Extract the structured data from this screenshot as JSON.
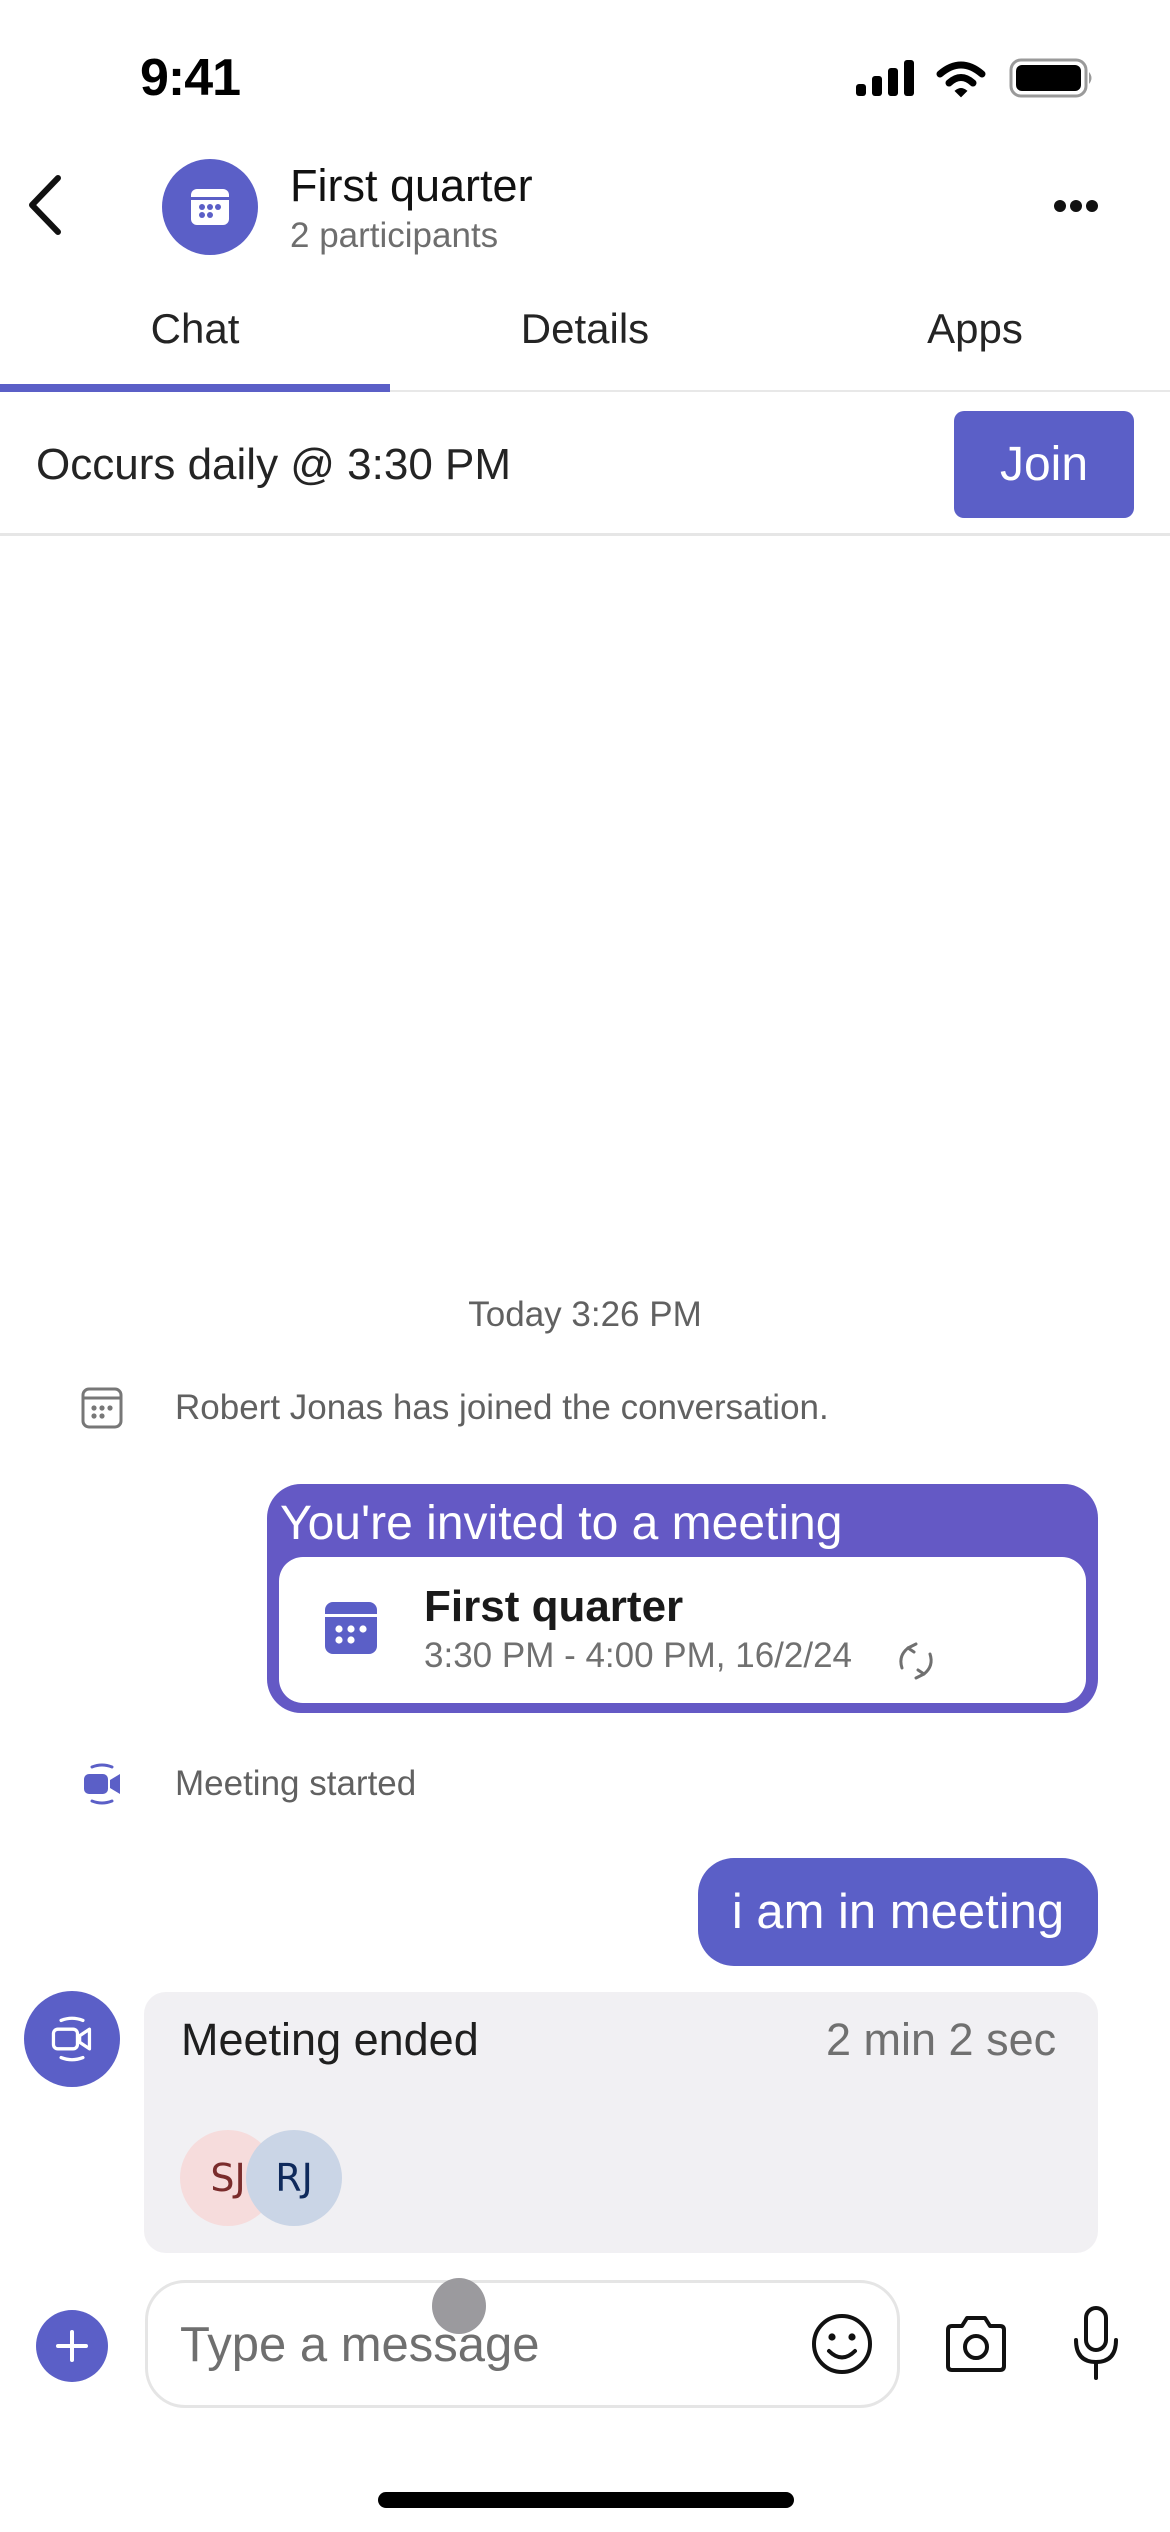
{
  "status_bar": {
    "time": "9:41",
    "icons": [
      "cellular-signal-icon",
      "wifi-icon",
      "battery-icon"
    ]
  },
  "header": {
    "back_icon": "chevron-left-icon",
    "avatar_icon": "calendar-icon",
    "title": "First quarter",
    "subtitle": "2 participants",
    "more_icon": "more-horizontal-icon"
  },
  "tabs": [
    {
      "label": "Chat",
      "active": true
    },
    {
      "label": "Details",
      "active": false
    },
    {
      "label": "Apps",
      "active": false
    }
  ],
  "meeting_bar": {
    "recurrence": "Occurs daily @ 3:30 PM",
    "join_label": "Join"
  },
  "conversation": {
    "timestamp": "Today 3:26 PM",
    "system_joined": {
      "icon": "calendar-icon",
      "text": "Robert Jonas has joined the conversation."
    },
    "invite": {
      "heading": "You're invited to a meeting",
      "meeting_name": "First quarter",
      "meeting_time": "3:30 PM - 4:00 PM, 16/2/24",
      "recurring_icon": "repeat-icon"
    },
    "system_started": {
      "icon": "video-call-icon",
      "text": "Meeting started"
    },
    "message": {
      "text": "i am in meeting"
    },
    "meeting_ended": {
      "icon": "video-call-icon",
      "title": "Meeting ended",
      "duration": "2 min 2 sec",
      "participants": [
        {
          "initials": "SJ"
        },
        {
          "initials": "RJ"
        }
      ]
    }
  },
  "composer": {
    "add_icon": "plus-icon",
    "placeholder": "Type a message",
    "value": "",
    "emoji_icon": "emoji-icon",
    "camera_icon": "camera-icon",
    "mic_icon": "microphone-icon"
  },
  "colors": {
    "brand": "#5b5fc7",
    "invite_bubble": "#6459c5",
    "card_background": "#f1f0f3",
    "secondary_text": "#616161"
  }
}
